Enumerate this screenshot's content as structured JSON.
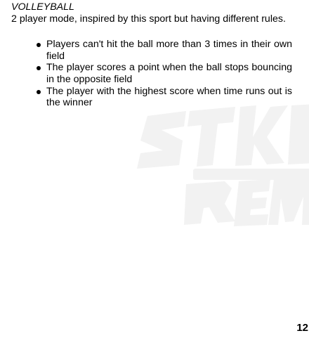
{
  "section": {
    "title": "VOLLEYBALL",
    "intro": "2 player mode, inspired by this sport but having different rules."
  },
  "rules": [
    "Players can't hit the ball more than 3 times in their own field",
    "The player scores a point when the ball stops bouncing in the opposite field",
    "The player with the highest score when time runs out is the winner"
  ],
  "page_number": "12",
  "watermark": {
    "icon": "game-logo-watermark",
    "color": "#f2f2f2"
  }
}
